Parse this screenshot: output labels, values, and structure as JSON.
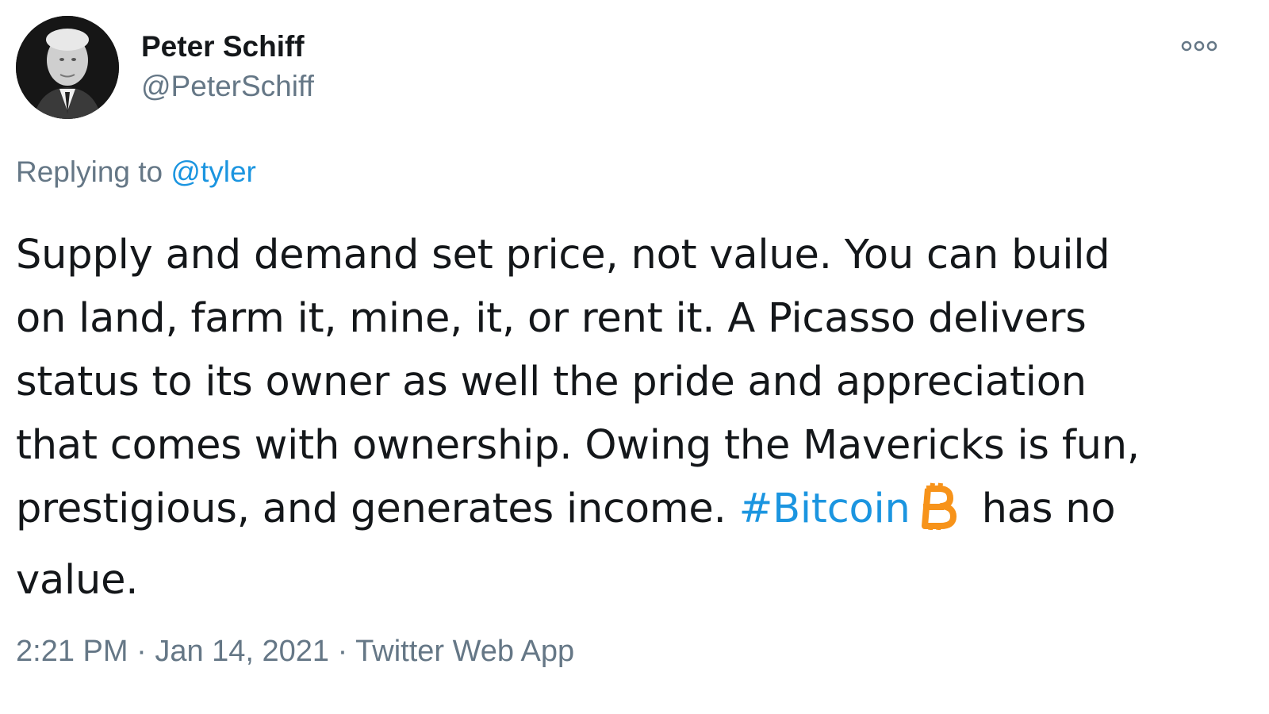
{
  "author": {
    "name": "Peter Schiff",
    "handle": "@PeterSchiff"
  },
  "more_icon": "more-options-icon",
  "reply": {
    "prefix": "Replying to ",
    "mention": "@tyler"
  },
  "body": {
    "line1": "Supply and demand set price, not value. You can build",
    "line2": "on land, farm it, mine, it, or rent it. A Picasso delivers",
    "line3": "status to its owner as well the pride and appreciation",
    "line4": "that comes with ownership. Owing the Mavericks is fun,",
    "line5_prefix": "prestigious, and generates income. ",
    "hashtag": "#Bitcoin",
    "emoji": "bitcoin-icon",
    "line5_suffix": "has no",
    "line6": "value."
  },
  "meta": {
    "time": "2:21 PM",
    "sep1": " · ",
    "date": "Jan 14, 2021",
    "sep2": " · ",
    "source": "Twitter Web App"
  },
  "colors": {
    "link": "#1b95e0",
    "secondary_text": "#657786",
    "primary_text": "#14171a",
    "bitcoin_orange": "#f7931a"
  }
}
